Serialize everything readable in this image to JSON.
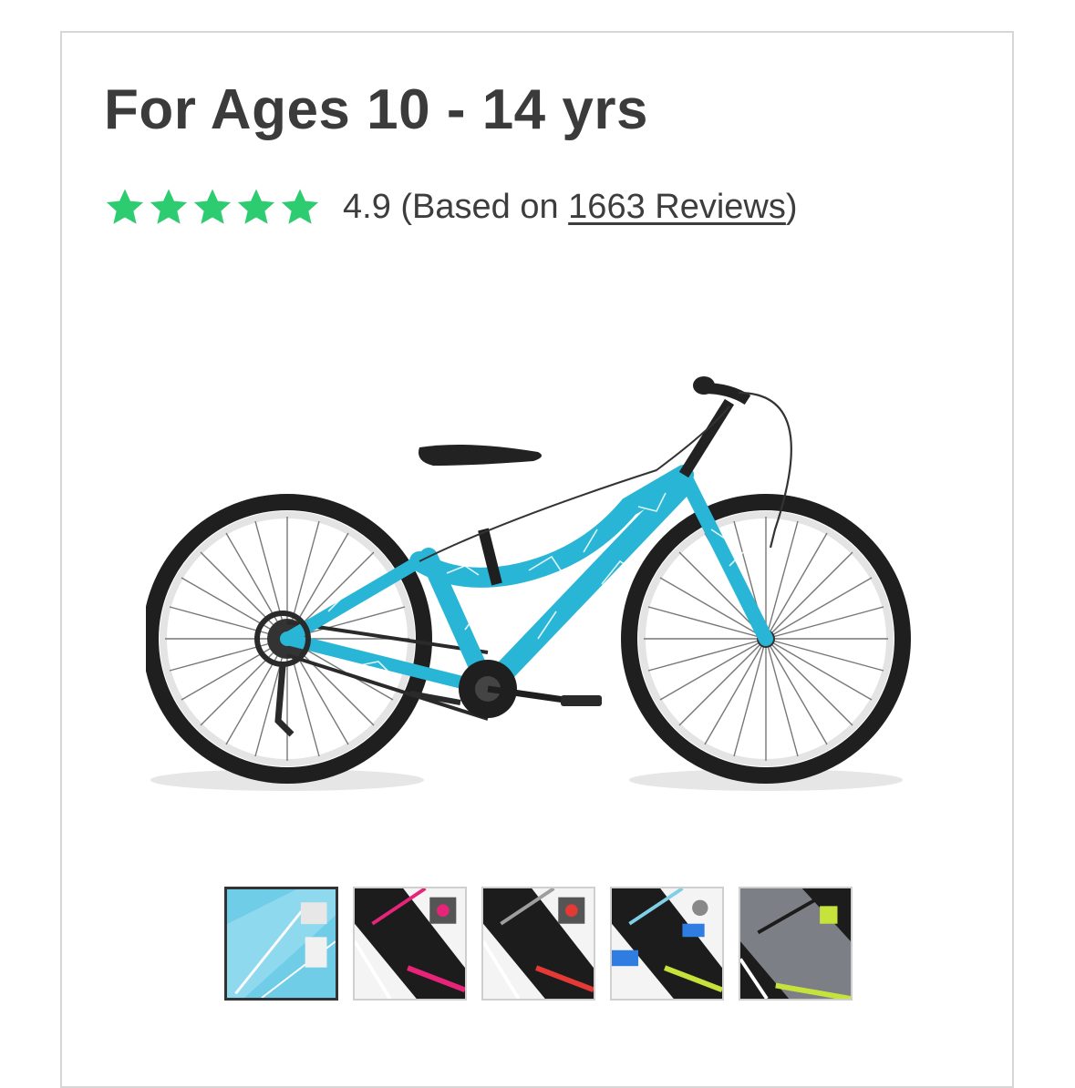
{
  "product": {
    "title": "For Ages 10 - 14 yrs",
    "rating": {
      "value": "4.9",
      "stars": 5,
      "star_color": "#2ecc71",
      "prefix": " (Based on ",
      "reviews_link": "1663 Reviews",
      "suffix": ")"
    },
    "image": {
      "icon": "bicycle-image",
      "frame_color": "#29b6d6"
    },
    "color_options": [
      {
        "name": "teal",
        "base": "#6fcde8",
        "accent": "#ffffff",
        "selected": true
      },
      {
        "name": "black-pink",
        "base": "#1c1c1c",
        "accent": "#e8247a",
        "selected": false
      },
      {
        "name": "black-red",
        "base": "#1c1c1c",
        "accent": "#e53935",
        "selected": false
      },
      {
        "name": "black-blue",
        "base": "#1c1c1c",
        "accent": "#2f7de1",
        "selected": false
      },
      {
        "name": "gray-lime",
        "base": "#7d7f86",
        "accent": "#c6e33b",
        "selected": false
      }
    ]
  }
}
